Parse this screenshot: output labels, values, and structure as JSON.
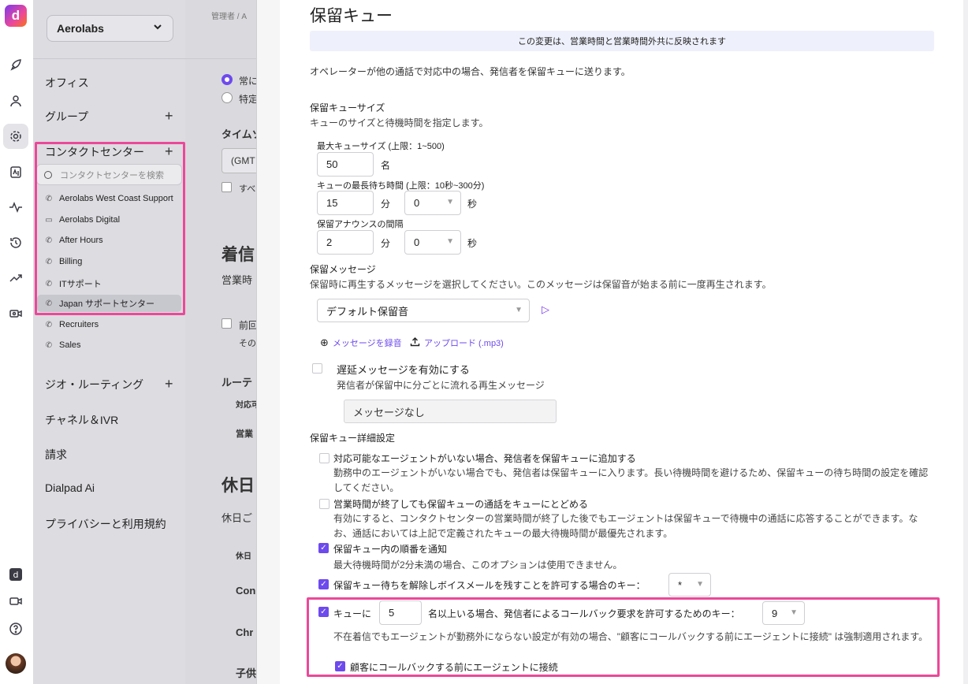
{
  "rail": {
    "icons": [
      "dialpad-logo-icon",
      "rocket-icon",
      "person-icon",
      "gear-icon",
      "badge-icon",
      "activity-icon",
      "history-icon",
      "trend-icon",
      "video-person-icon",
      "dialpad-app-icon",
      "video-icon",
      "help-icon",
      "avatar"
    ]
  },
  "sidebar": {
    "company": "Aerolabs",
    "nav": {
      "office": "オフィス",
      "group": "グループ",
      "contact_center": "コンタクトセンター",
      "geo_routing": "ジオ・ルーティング",
      "channel_ivr": "チャネル＆IVR",
      "billing": "請求",
      "dialpad_ai": "Dialpad Ai",
      "privacy": "プライバシーと利用規約"
    },
    "search_placeholder": "コンタクトセンターを検索",
    "contact_centers": [
      {
        "label": "Aerolabs West Coast Support",
        "icon": "phone-icon"
      },
      {
        "label": "Aerolabs Digital",
        "icon": "monitor-icon"
      },
      {
        "label": "After Hours",
        "icon": "phone-icon"
      },
      {
        "label": "Billing",
        "icon": "phone-icon"
      },
      {
        "label": "ITサポート",
        "icon": "phone-icon"
      },
      {
        "label": "Japan サポートセンター",
        "icon": "phone-icon"
      },
      {
        "label": "Recruiters",
        "icon": "phone-icon"
      },
      {
        "label": "Sales",
        "icon": "phone-icon"
      }
    ]
  },
  "background": {
    "breadcrumb": "管理者 / A",
    "radio1": "常に",
    "radio2": "特定",
    "timezone_label": "タイムゾ",
    "timezone_value": "(GMT",
    "check1": "すべ",
    "incoming_heading": "着信",
    "business_hours": "営業時",
    "prev_check": "前回",
    "prev_sub": "その",
    "routing": "ルーテ",
    "routing_col": "対応可",
    "routing_row": "営業",
    "holiday_heading": "休日",
    "holiday_sub": "休日ご",
    "holiday_col": "休日",
    "row1": "Con",
    "row2": "Chr",
    "row3": "子供"
  },
  "panel": {
    "title": "保留キュー",
    "banner": "この変更は、営業時間と営業時間外共に反映されます",
    "intro": "オペレーターが他の通話で対応中の場合、発信者を保留キューに送ります。",
    "size_section": {
      "title": "保留キューサイズ",
      "subtitle": "キューのサイズと待機時間を指定します。",
      "max_size_label": "最大キューサイズ (上限：1~500)",
      "max_size_value": "50",
      "max_size_unit": "名",
      "max_wait_label": "キューの最長待ち時間 (上限：10秒~300分)",
      "max_wait_min": "15",
      "min_unit": "分",
      "max_wait_sec": "0",
      "sec_unit": "秒",
      "announce_label": "保留アナウンスの間隔",
      "announce_min": "2",
      "announce_sec": "0"
    },
    "message_section": {
      "title": "保留メッセージ",
      "subtitle": "保留時に再生するメッセージを選択してください。このメッセージは保留音が始まる前に一度再生されます。",
      "selected": "デフォルト保留音",
      "record_link": "メッセージを録音",
      "upload_link": "アップロード (.mp3)"
    },
    "delay": {
      "label": "遅延メッセージを有効にする",
      "sub": "発信者が保留中に分ごとに流れる再生メッセージ",
      "value": "メッセージなし"
    },
    "advanced": {
      "title": "保留キュー詳細設定",
      "opt1_label": "対応可能なエージェントがいない場合、発信者を保留キューに追加する",
      "opt1_desc": "勤務中のエージェントがいない場合でも、発信者は保留キューに入ります。長い待機時間を避けるため、保留キューの待ち時間の設定を確認してください。",
      "opt2_label": "営業時間が終了しても保留キューの通話をキューにとどめる",
      "opt2_desc": "有効にすると、コンタクトセンターの営業時間が終了した後でもエージェントは保留キューで待機中の通話に応答することができます。なお、通話においては上記で定義されたキューの最大待機時間が最優先されます。",
      "opt3_label": "保留キュー内の順番を通知",
      "opt3_desc": "最大待機時間が2分未満の場合、このオプションは使用できません。",
      "opt4_label": "保留キュー待ちを解除しボイスメールを残すことを許可する場合のキー：",
      "opt4_key": "*",
      "opt5_prefix": "キューに",
      "opt5_count": "5",
      "opt5_suffix": "名以上いる場合、発信者によるコールバック要求を許可するためのキー：",
      "opt5_key": "9",
      "opt5_desc": "不在着信でもエージェントが勤務外にならない設定が有効の場合、\"顧客にコールバックする前にエージェントに接続\" は強制適用されます。",
      "opt6_label": "顧客にコールバックする前にエージェントに接続"
    }
  }
}
